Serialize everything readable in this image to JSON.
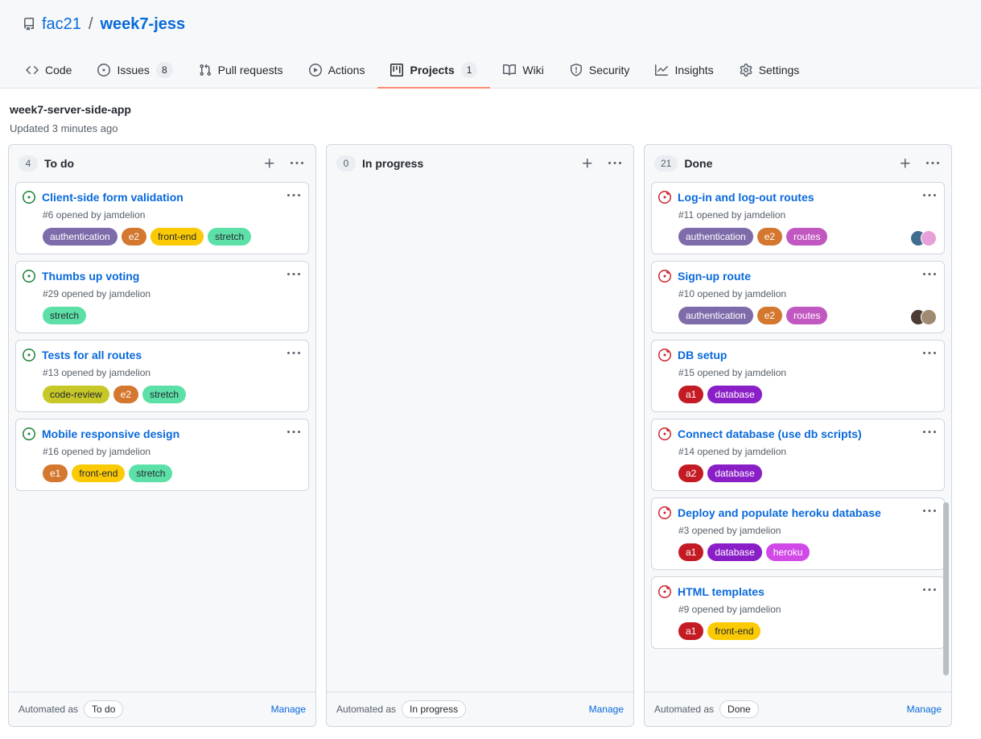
{
  "repo": {
    "icon": "repo-icon",
    "owner": "fac21",
    "separator": "/",
    "name": "week7-jess"
  },
  "nav": {
    "tabs": [
      {
        "label": "Code",
        "icon": "code-icon",
        "counter": null,
        "selected": false
      },
      {
        "label": "Issues",
        "icon": "issue-opened-icon",
        "counter": "8",
        "selected": false
      },
      {
        "label": "Pull requests",
        "icon": "git-pull-request-icon",
        "counter": null,
        "selected": false
      },
      {
        "label": "Actions",
        "icon": "play-icon",
        "counter": null,
        "selected": false
      },
      {
        "label": "Projects",
        "icon": "project-icon",
        "counter": "1",
        "selected": true
      },
      {
        "label": "Wiki",
        "icon": "book-icon",
        "counter": null,
        "selected": false
      },
      {
        "label": "Security",
        "icon": "shield-icon",
        "counter": null,
        "selected": false
      },
      {
        "label": "Insights",
        "icon": "graph-icon",
        "counter": null,
        "selected": false
      },
      {
        "label": "Settings",
        "icon": "gear-icon",
        "counter": null,
        "selected": false
      }
    ]
  },
  "project": {
    "name": "week7-server-side-app",
    "updated": "Updated 3 minutes ago"
  },
  "colors": {
    "accent": "#0969da",
    "selected_tab_underline": "#fd8c73",
    "open_issue": "#1a7f37",
    "closed_issue": "#cf222e",
    "labels": {
      "authentication": "#7e6baa",
      "e2": "#d4772f",
      "e1": "#d4772f",
      "front-end": "#fbca04",
      "stretch": "#5ce0a8",
      "code-review": "#c7c827",
      "routes": "#c158c1",
      "a1": "#c41a23",
      "a2": "#c41a23",
      "database": "#8b1fc7",
      "heroku": "#d14ae8"
    }
  },
  "board": {
    "add_label": "+",
    "more_label": "···",
    "automated_prefix": "Automated as",
    "manage_label": "Manage",
    "columns": [
      {
        "title": "To do",
        "count": "4",
        "automated_as": "To do",
        "manage": "Manage",
        "cards": [
          {
            "icon": "issue-opened-icon",
            "state": "open",
            "title": "Client-side form validation",
            "meta": "#6 opened by jamdelion",
            "labels": [
              {
                "name": "authentication",
                "bg": "#7e6baa",
                "fg": "#ffffff"
              },
              {
                "name": "e2",
                "bg": "#d4772f",
                "fg": "#ffffff"
              },
              {
                "name": "front-end",
                "bg": "#fbca04",
                "fg": "#24292f"
              },
              {
                "name": "stretch",
                "bg": "#5ce0a8",
                "fg": "#24292f"
              }
            ],
            "avatars": []
          },
          {
            "icon": "issue-opened-icon",
            "state": "open",
            "title": "Thumbs up voting",
            "meta": "#29 opened by jamdelion",
            "labels": [
              {
                "name": "stretch",
                "bg": "#5ce0a8",
                "fg": "#24292f"
              }
            ],
            "avatars": []
          },
          {
            "icon": "issue-opened-icon",
            "state": "open",
            "title": "Tests for all routes",
            "meta": "#13 opened by jamdelion",
            "labels": [
              {
                "name": "code-review",
                "bg": "#c7c827",
                "fg": "#24292f"
              },
              {
                "name": "e2",
                "bg": "#d4772f",
                "fg": "#ffffff"
              },
              {
                "name": "stretch",
                "bg": "#5ce0a8",
                "fg": "#24292f"
              }
            ],
            "avatars": []
          },
          {
            "icon": "issue-opened-icon",
            "state": "open",
            "title": "Mobile responsive design",
            "meta": "#16 opened by jamdelion",
            "labels": [
              {
                "name": "e1",
                "bg": "#d4772f",
                "fg": "#ffffff"
              },
              {
                "name": "front-end",
                "bg": "#fbca04",
                "fg": "#24292f"
              },
              {
                "name": "stretch",
                "bg": "#5ce0a8",
                "fg": "#24292f"
              }
            ],
            "avatars": []
          }
        ]
      },
      {
        "title": "In progress",
        "count": "0",
        "automated_as": "In progress",
        "manage": "Manage",
        "cards": []
      },
      {
        "title": "Done",
        "count": "21",
        "automated_as": "Done",
        "manage": "Manage",
        "cards": [
          {
            "icon": "issue-closed-not-planned-icon",
            "state": "closed",
            "title": "Log-in and log-out routes",
            "meta": "#11 opened by jamdelion",
            "labels": [
              {
                "name": "authentication",
                "bg": "#7e6baa",
                "fg": "#ffffff"
              },
              {
                "name": "e2",
                "bg": "#d4772f",
                "fg": "#ffffff"
              },
              {
                "name": "routes",
                "bg": "#c158c1",
                "fg": "#ffffff"
              }
            ],
            "avatars": [
              "#3f6d8e",
              "#e8a0d8"
            ]
          },
          {
            "icon": "issue-closed-not-planned-icon",
            "state": "closed",
            "title": "Sign-up route",
            "meta": "#10 opened by jamdelion",
            "labels": [
              {
                "name": "authentication",
                "bg": "#7e6baa",
                "fg": "#ffffff"
              },
              {
                "name": "e2",
                "bg": "#d4772f",
                "fg": "#ffffff"
              },
              {
                "name": "routes",
                "bg": "#c158c1",
                "fg": "#ffffff"
              }
            ],
            "avatars": [
              "#4a3b33",
              "#a08b72"
            ]
          },
          {
            "icon": "issue-closed-not-planned-icon",
            "state": "closed",
            "title": "DB setup",
            "meta": "#15 opened by jamdelion",
            "labels": [
              {
                "name": "a1",
                "bg": "#c41a23",
                "fg": "#ffffff"
              },
              {
                "name": "database",
                "bg": "#8b1fc7",
                "fg": "#ffffff"
              }
            ],
            "avatars": []
          },
          {
            "icon": "issue-closed-not-planned-icon",
            "state": "closed",
            "title": "Connect database (use db scripts)",
            "meta": "#14 opened by jamdelion",
            "labels": [
              {
                "name": "a2",
                "bg": "#c41a23",
                "fg": "#ffffff"
              },
              {
                "name": "database",
                "bg": "#8b1fc7",
                "fg": "#ffffff"
              }
            ],
            "avatars": []
          },
          {
            "icon": "issue-closed-not-planned-icon",
            "state": "closed",
            "title": "Deploy and populate heroku database",
            "meta": "#3 opened by jamdelion",
            "labels": [
              {
                "name": "a1",
                "bg": "#c41a23",
                "fg": "#ffffff"
              },
              {
                "name": "database",
                "bg": "#8b1fc7",
                "fg": "#ffffff"
              },
              {
                "name": "heroku",
                "bg": "#d14ae8",
                "fg": "#ffffff"
              }
            ],
            "avatars": []
          },
          {
            "icon": "issue-closed-not-planned-icon",
            "state": "closed",
            "title": "HTML templates",
            "meta": "#9 opened by jamdelion",
            "labels": [
              {
                "name": "a1",
                "bg": "#c41a23",
                "fg": "#ffffff"
              },
              {
                "name": "front-end",
                "bg": "#fbca04",
                "fg": "#24292f"
              }
            ],
            "avatars": []
          }
        ]
      }
    ]
  }
}
